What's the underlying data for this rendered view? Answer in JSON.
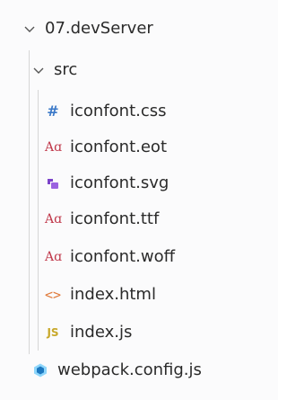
{
  "explorer": {
    "project_folder": "07.devServer",
    "src_folder": "src",
    "files": [
      {
        "name": "iconfont.css",
        "icon": "css-hash-icon"
      },
      {
        "name": "iconfont.eot",
        "icon": "font-file-icon"
      },
      {
        "name": "iconfont.svg",
        "icon": "svg-file-icon"
      },
      {
        "name": "iconfont.ttf",
        "icon": "font-file-icon"
      },
      {
        "name": "iconfont.woff",
        "icon": "font-file-icon"
      },
      {
        "name": "index.html",
        "icon": "html-file-icon"
      },
      {
        "name": "index.js",
        "icon": "js-file-icon"
      }
    ],
    "root_file": {
      "name": "webpack.config.js",
      "icon": "webpack-file-icon"
    }
  },
  "icon_glyphs": {
    "css": "#",
    "font": "Aɑ",
    "html": "<>",
    "js": "JS"
  },
  "colors": {
    "css_icon": "#3b79c8",
    "font_icon": "#c0394b",
    "svg_icon": "#7b42c9",
    "html_icon": "#e07b3c",
    "js_icon": "#c8a82a",
    "webpack_icon": "#2e7fb8"
  }
}
